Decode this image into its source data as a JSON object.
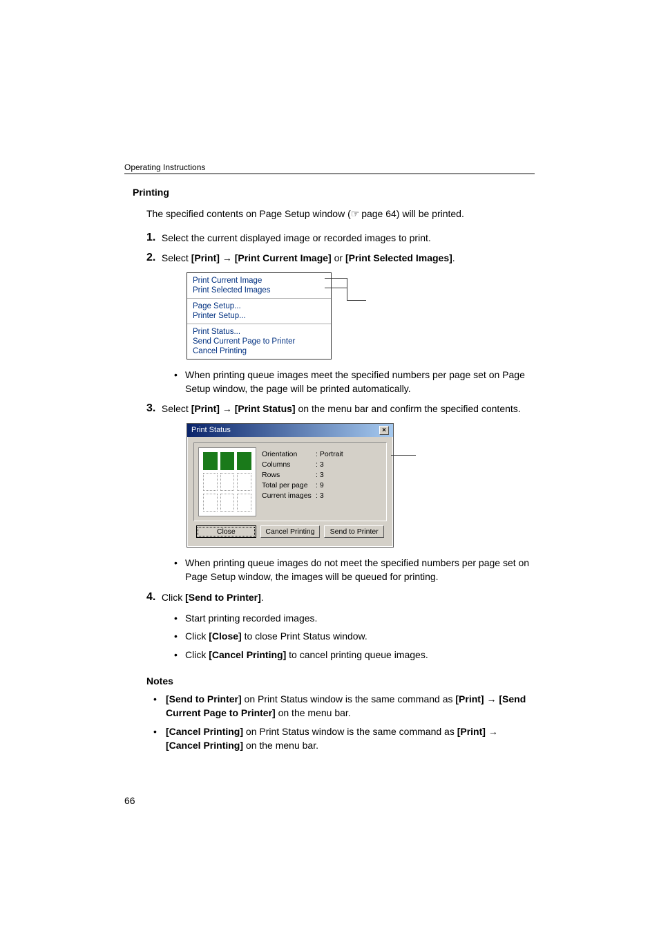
{
  "header": "Operating Instructions",
  "section_title": "Printing",
  "intro": {
    "prefix": "The specified contents on Page Setup window (",
    "ref": " page 64) will be printed."
  },
  "steps": {
    "s1": {
      "num": "1.",
      "text": "Select the current displayed image or recorded images to print."
    },
    "s2": {
      "num": "2.",
      "p1": "Select ",
      "b1": "[Print]",
      "arrow": " → ",
      "b2": "[Print Current Image]",
      "p2": " or ",
      "b3": "[Print Selected Images]",
      "p3": "."
    },
    "s2_bullet": "When printing queue images meet the specified numbers per page set on Page Setup window, the page will be printed automatically.",
    "s3": {
      "num": "3.",
      "p1": "Select ",
      "b1": "[Print]",
      "arrow": " → ",
      "b2": "[Print Status]",
      "p2": " on the menu bar and confirm the specified contents."
    },
    "s3_bullet": "When printing queue images do not meet the specified numbers per page set on Page Setup window, the images will be queued for printing.",
    "s4": {
      "num": "4.",
      "p1": "Click ",
      "b1": "[Send to Printer]",
      "p2": "."
    },
    "s4_b1": "Start printing recorded images.",
    "s4_b2a": "Click ",
    "s4_b2b": "[Close]",
    "s4_b2c": " to close Print Status window.",
    "s4_b3a": "Click ",
    "s4_b3b": "[Cancel Printing]",
    "s4_b3c": " to cancel printing queue images."
  },
  "menu": {
    "g1i1": "Print Current Image",
    "g1i2": "Print Selected Images",
    "g2i1": "Page Setup...",
    "g2i2": "Printer Setup...",
    "g3i1": "Print Status...",
    "g3i2": "Send Current Page to Printer",
    "g3i3": "Cancel Printing"
  },
  "print_status": {
    "title": "Print Status",
    "orientation_l": "Orientation",
    "orientation_v": ": Portrait",
    "columns_l": "Columns",
    "columns_v": ": 3",
    "rows_l": "Rows",
    "rows_v": ": 3",
    "total_l": "Total per page",
    "total_v": ": 9",
    "current_l": "Current images",
    "current_v": ": 3",
    "close": "Close",
    "cancel": "Cancel Printing",
    "send": "Send to Printer"
  },
  "notes": {
    "title": "Notes",
    "n1a": "[Send to Printer]",
    "n1b": " on Print Status window is the same command as ",
    "n1c": "[Print]",
    "n1arrow": " → ",
    "n1d": "[Send Current Page to Printer]",
    "n1e": " on the menu bar.",
    "n2a": "[Cancel Printing]",
    "n2b": " on Print Status window is the same command as ",
    "n2c": "[Print]",
    "n2arrow": " → ",
    "n2d": "[Cancel Printing]",
    "n2e": " on the menu bar."
  },
  "page_number": "66"
}
